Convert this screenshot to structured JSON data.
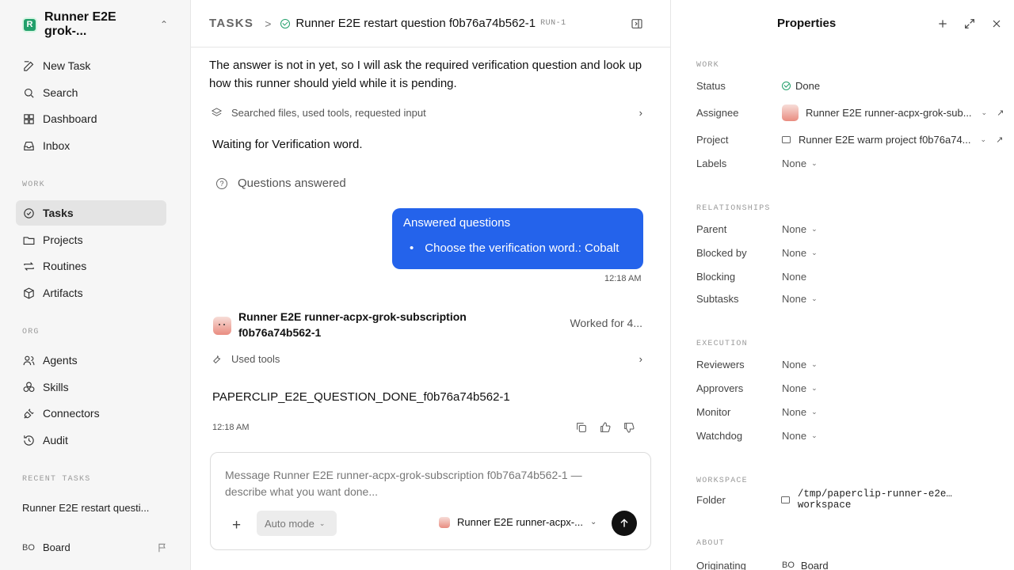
{
  "workspace": {
    "logo_letter": "R",
    "name": "Runner E2E grok-..."
  },
  "sidebar": {
    "main_items": [
      {
        "label": "New Task"
      },
      {
        "label": "Search"
      },
      {
        "label": "Dashboard"
      },
      {
        "label": "Inbox"
      }
    ],
    "work_section": "WORK",
    "work_items": [
      {
        "label": "Tasks",
        "active": true
      },
      {
        "label": "Projects"
      },
      {
        "label": "Routines"
      },
      {
        "label": "Artifacts"
      }
    ],
    "org_section": "ORG",
    "org_items": [
      {
        "label": "Agents"
      },
      {
        "label": "Skills"
      },
      {
        "label": "Connectors"
      },
      {
        "label": "Audit"
      }
    ],
    "recent_section": "RECENT TASKS",
    "recent_item": "Runner E2E restart questi...",
    "board_initials": "BO",
    "board_label": "Board"
  },
  "header": {
    "crumb": "TASKS",
    "task_title": "Runner E2E restart question f0b76a74b562-1",
    "run_tag": "RUN-1"
  },
  "thread": {
    "intro": "The answer is not in yet, so I will ask the required verification question and look up how this runner should yield while it is pending.",
    "tools_summary_1": "Searched files, used tools, requested input",
    "waiting": "Waiting for Verification word.",
    "questions_answered": "Questions answered",
    "bubble_title": "Answered questions",
    "bubble_item": "Choose the verification word.: Cobalt",
    "bubble_time": "12:18 AM",
    "agent_name": "Runner E2E runner-acpx-grok-subscription f0b76a74b562-1",
    "worked_for": "Worked for 4...",
    "tools_summary_2": "Used tools",
    "done_text": "PAPERCLIP_E2E_QUESTION_DONE_f0b76a74b562-1",
    "done_time": "12:18 AM"
  },
  "composer": {
    "placeholder": "Message Runner E2E runner-acpx-grok-subscription f0b76a74b562-1 — describe what you want done...",
    "mode": "Auto mode",
    "agent": "Runner E2E runner-acpx-..."
  },
  "properties": {
    "title": "Properties",
    "work_section": "WORK",
    "status_label": "Status",
    "status_value": "Done",
    "assignee_label": "Assignee",
    "assignee_value": "Runner E2E runner-acpx-grok-sub...",
    "project_label": "Project",
    "project_value": "Runner E2E warm project f0b76a74...",
    "labels_label": "Labels",
    "labels_value": "None",
    "relationships_section": "RELATIONSHIPS",
    "parent_label": "Parent",
    "parent_value": "None",
    "blockedby_label": "Blocked by",
    "blockedby_value": "None",
    "blocking_label": "Blocking",
    "blocking_value": "None",
    "subtasks_label": "Subtasks",
    "subtasks_value": "None",
    "execution_section": "EXECUTION",
    "reviewers_label": "Reviewers",
    "reviewers_value": "None",
    "approvers_label": "Approvers",
    "approvers_value": "None",
    "monitor_label": "Monitor",
    "monitor_value": "None",
    "watchdog_label": "Watchdog",
    "watchdog_value": "None",
    "workspace_section": "WORKSPACE",
    "folder_label": "Folder",
    "folder_value": "/tmp/paperclip-runner-e2e… workspace",
    "about_section": "ABOUT",
    "originating_label": "Originating",
    "originating_initials": "BO",
    "originating_value": "Board"
  },
  "colors": {
    "accent": "#2463eb",
    "success": "#22a06b"
  }
}
